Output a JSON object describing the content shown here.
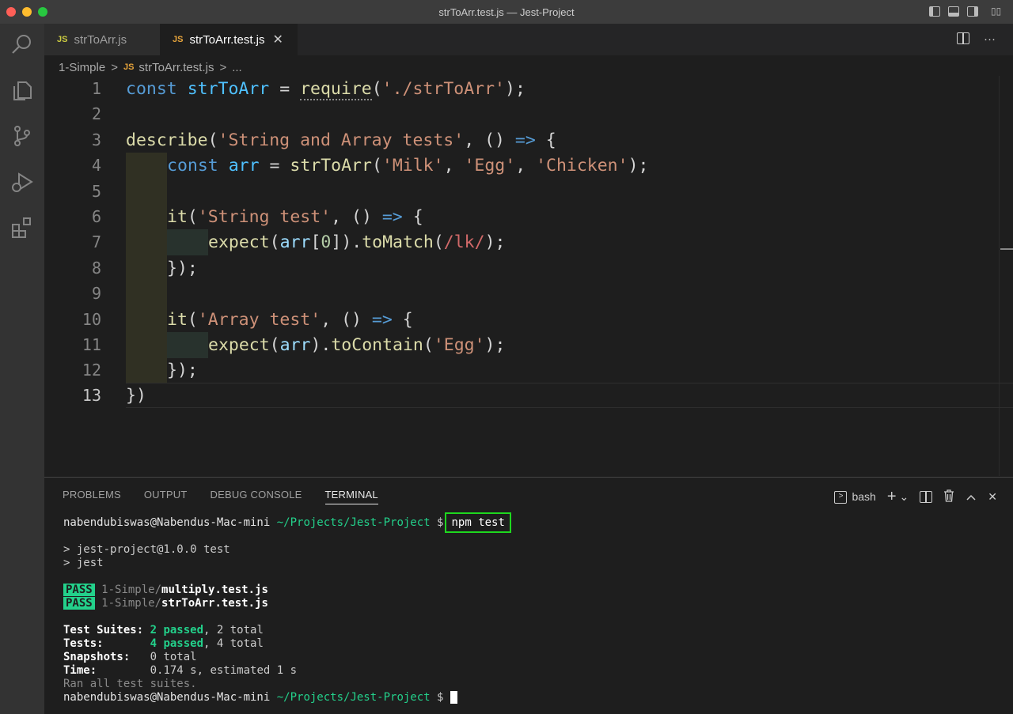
{
  "window": {
    "title": "strToArr.test.js — Jest-Project"
  },
  "tabs": [
    {
      "badge": "JS",
      "label": "strToArr.js"
    },
    {
      "badge": "JS",
      "label": "strToArr.test.js",
      "close": "✕"
    }
  ],
  "tab_actions": {
    "more": "···"
  },
  "breadcrumb": {
    "folder": "1-Simple",
    "sep": ">",
    "badge": "JS",
    "file": "strToArr.test.js",
    "ellipsis": "..."
  },
  "editor": {
    "line_numbers": [
      "1",
      "2",
      "3",
      "4",
      "5",
      "6",
      "7",
      "8",
      "9",
      "10",
      "11",
      "12",
      "13"
    ],
    "lines": {
      "l1": [
        "const",
        " ",
        "strToArr",
        " = ",
        "require",
        "(",
        "'./strToArr'",
        ");"
      ],
      "l3": [
        "describe",
        "(",
        "'String and Array tests'",
        ", () ",
        "=>",
        " {"
      ],
      "l4": [
        "const",
        " ",
        "arr",
        " = ",
        "strToArr",
        "(",
        "'Milk'",
        ", ",
        "'Egg'",
        ", ",
        "'Chicken'",
        ");"
      ],
      "l6": [
        "it",
        "(",
        "'String test'",
        ", () ",
        "=>",
        " {"
      ],
      "l7": [
        "expect",
        "(",
        "arr",
        "[",
        "0",
        "]).",
        "toMatch",
        "(",
        "/lk/",
        ");"
      ],
      "l8": [
        "});"
      ],
      "l10": [
        "it",
        "(",
        "'Array test'",
        ", () ",
        "=>",
        " {"
      ],
      "l11": [
        "expect",
        "(",
        "arr",
        ").",
        "toContain",
        "(",
        "'Egg'",
        ");"
      ],
      "l12": [
        "});"
      ],
      "l13": [
        "})"
      ]
    }
  },
  "panel": {
    "tabs": [
      "PROBLEMS",
      "OUTPUT",
      "DEBUG CONSOLE",
      "TERMINAL"
    ],
    "active_tab": "TERMINAL",
    "shell": "bash",
    "actions": {
      "add": "+",
      "dropdown": "⌄",
      "trash": "🗑",
      "maximize": "^",
      "close": "✕"
    }
  },
  "terminal": {
    "prompt_user": "nabendubiswas@Nabendus-Mac-mini",
    "prompt_path": "~/Projects/Jest-Project",
    "prompt_symbol": "$",
    "command": "npm test",
    "script_line1": "> jest-project@1.0.0 test",
    "script_line2": "> jest",
    "pass_label": "PASS",
    "results": [
      {
        "dir": "1-Simple/",
        "file": "multiply.test.js"
      },
      {
        "dir": "1-Simple/",
        "file": "strToArr.test.js"
      }
    ],
    "summary": {
      "suites_label": "Test Suites:",
      "suites_passed": "2 passed",
      "suites_total": ", 2 total",
      "tests_label": "Tests:",
      "tests_passed": "4 passed",
      "tests_total": ", 4 total",
      "snapshots_label": "Snapshots:",
      "snapshots_value": "0 total",
      "time_label": "Time:",
      "time_value": "0.174 s, estimated 1 s",
      "ran": "Ran all test suites."
    }
  },
  "colors": {
    "pass_badge": "#23d18b",
    "command_highlight": "#1ed81e",
    "path": "#23d18b"
  }
}
